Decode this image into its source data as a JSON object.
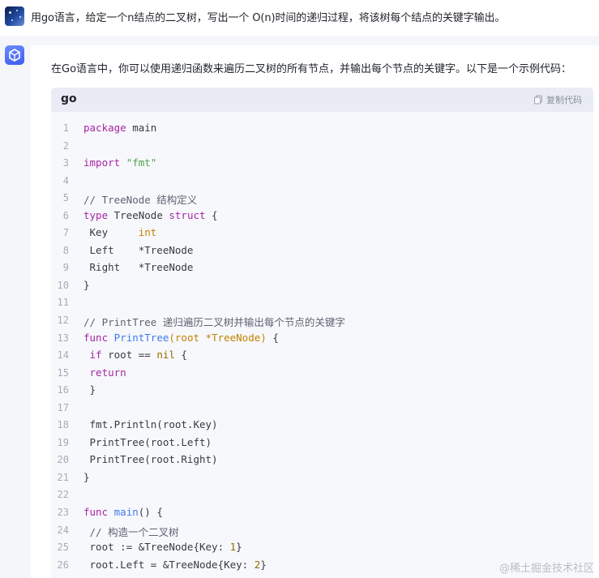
{
  "user_message": {
    "text": "用go语言，给定一个n结点的二叉树，写出一个 O(n)时间的递归过程，将该树每个结点的关键字输出。"
  },
  "answer": {
    "intro": "在Go语言中，你可以使用递归函数来遍历二叉树的所有节点，并输出每个节点的关键字。以下是一个示例代码：",
    "code_block": {
      "language": "go",
      "copy_label": "复制代码",
      "lines": [
        {
          "n": "1",
          "segments": [
            {
              "t": "package",
              "c": "kw"
            },
            {
              "t": " main",
              "c": ""
            }
          ]
        },
        {
          "n": "2",
          "segments": []
        },
        {
          "n": "3",
          "segments": [
            {
              "t": "import",
              "c": "kw"
            },
            {
              "t": " ",
              "c": ""
            },
            {
              "t": "\"fmt\"",
              "c": "str"
            }
          ]
        },
        {
          "n": "4",
          "segments": []
        },
        {
          "n": "5",
          "segments": [
            {
              "t": "// TreeNode 结构定义",
              "c": "cm"
            }
          ]
        },
        {
          "n": "6",
          "segments": [
            {
              "t": "type",
              "c": "kw"
            },
            {
              "t": " TreeNode ",
              "c": ""
            },
            {
              "t": "struct",
              "c": "kw"
            },
            {
              "t": " {",
              "c": ""
            }
          ]
        },
        {
          "n": "7",
          "segments": [
            {
              "t": " Key     ",
              "c": ""
            },
            {
              "t": "int",
              "c": "ty"
            }
          ]
        },
        {
          "n": "8",
          "segments": [
            {
              "t": " Left    *TreeNode",
              "c": ""
            }
          ]
        },
        {
          "n": "9",
          "segments": [
            {
              "t": " Right   *TreeNode",
              "c": ""
            }
          ]
        },
        {
          "n": "10",
          "segments": [
            {
              "t": "}",
              "c": ""
            }
          ]
        },
        {
          "n": "11",
          "segments": []
        },
        {
          "n": "12",
          "segments": [
            {
              "t": "// PrintTree 递归遍历二叉树并输出每个节点的关键字",
              "c": "cm"
            }
          ]
        },
        {
          "n": "13",
          "segments": [
            {
              "t": "func",
              "c": "kw"
            },
            {
              "t": " ",
              "c": ""
            },
            {
              "t": "PrintTree",
              "c": "fn"
            },
            {
              "t": "(root *TreeNode)",
              "c": "ty"
            },
            {
              "t": " {",
              "c": ""
            }
          ]
        },
        {
          "n": "14",
          "segments": [
            {
              "t": " ",
              "c": ""
            },
            {
              "t": "if",
              "c": "kw"
            },
            {
              "t": " root == ",
              "c": ""
            },
            {
              "t": "nil",
              "c": "num"
            },
            {
              "t": " {",
              "c": ""
            }
          ]
        },
        {
          "n": "15",
          "segments": [
            {
              "t": " ",
              "c": ""
            },
            {
              "t": "return",
              "c": "kw"
            }
          ]
        },
        {
          "n": "16",
          "segments": [
            {
              "t": " }",
              "c": ""
            }
          ]
        },
        {
          "n": "17",
          "segments": []
        },
        {
          "n": "18",
          "segments": [
            {
              "t": " fmt.Println(root.Key)",
              "c": ""
            }
          ]
        },
        {
          "n": "19",
          "segments": [
            {
              "t": " PrintTree(root.Left)",
              "c": ""
            }
          ]
        },
        {
          "n": "20",
          "segments": [
            {
              "t": " PrintTree(root.Right)",
              "c": ""
            }
          ]
        },
        {
          "n": "21",
          "segments": [
            {
              "t": "}",
              "c": ""
            }
          ]
        },
        {
          "n": "22",
          "segments": []
        },
        {
          "n": "23",
          "segments": [
            {
              "t": "func",
              "c": "kw"
            },
            {
              "t": " ",
              "c": ""
            },
            {
              "t": "main",
              "c": "fn"
            },
            {
              "t": "() {",
              "c": ""
            }
          ]
        },
        {
          "n": "24",
          "segments": [
            {
              "t": " // 构造一个二叉树",
              "c": "cm"
            }
          ]
        },
        {
          "n": "25",
          "segments": [
            {
              "t": " root := &TreeNode{Key: ",
              "c": ""
            },
            {
              "t": "1",
              "c": "num"
            },
            {
              "t": "}",
              "c": ""
            }
          ]
        },
        {
          "n": "26",
          "segments": [
            {
              "t": " root.Left = &TreeNode{Key: ",
              "c": ""
            },
            {
              "t": "2",
              "c": "num"
            },
            {
              "t": "}",
              "c": ""
            }
          ]
        }
      ]
    }
  },
  "watermark": "@稀土掘金技术社区",
  "colors": {
    "page_bg": "#f5f6fa",
    "code_bg": "#f7f8fc",
    "code_header_bg": "#e9ecf4",
    "bot_accent": "#4a68f5"
  }
}
